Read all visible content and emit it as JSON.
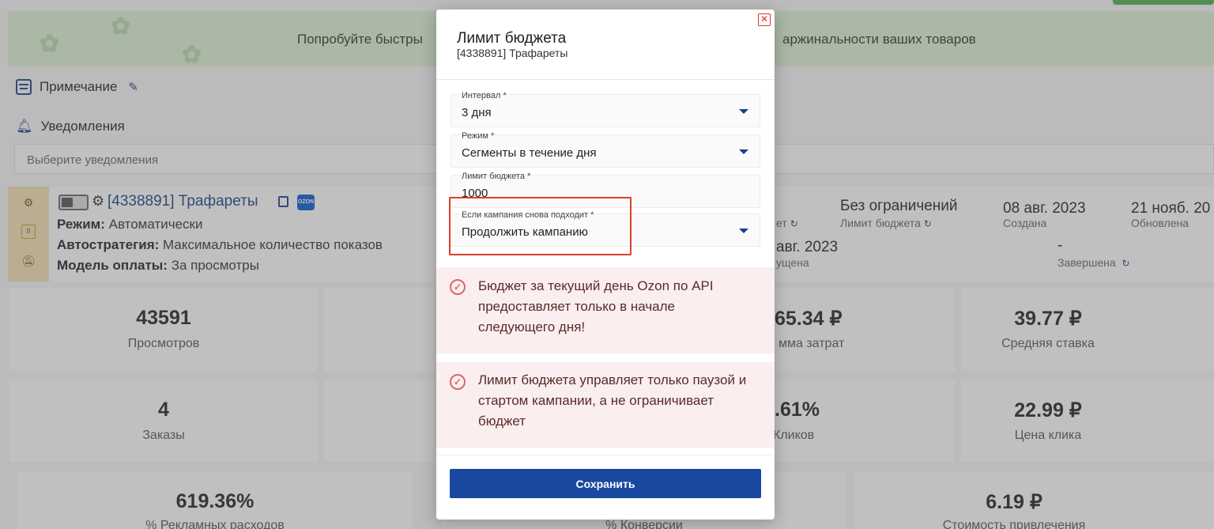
{
  "background": {
    "promo_text_left": "Попробуйте быстры",
    "promo_text_right": "аржинальности ваших товаров",
    "note_label": "Примечание",
    "notifications_label": "Уведомления",
    "notifications_placeholder": "Выберите уведомления",
    "campaign": {
      "title": "[4338891] Трафареты",
      "badge": "OZON",
      "mode_label": "Режим:",
      "mode_value": "Автоматически",
      "strategy_label": "Автостратегия:",
      "strategy_value": "Максимальное количество показов",
      "payment_label": "Модель оплаты:",
      "payment_value": "За просмотры"
    },
    "meta": {
      "limit_value": "Без ограничений",
      "limit_label": "Лимит бюджета",
      "created_value": "08 авг. 2023",
      "created_label": "Создана",
      "updated_value": "21 нояб. 20",
      "updated_label": "Обновлена",
      "launched_value": "авг. 2023",
      "launched_label": "ущена",
      "et_label": "ет",
      "finished_value": "-",
      "finished_label": "Завершена"
    },
    "cards": [
      {
        "value": "43591",
        "label": "Просмотров"
      },
      {
        "value": "65.34 ₽",
        "label": "мма затрат"
      },
      {
        "value": "39.77 ₽",
        "label": "Средняя ставка"
      },
      {
        "value": "4",
        "label": "Заказы"
      },
      {
        "value": ".61%",
        "label": "Кликов"
      },
      {
        "value": "22.99 ₽",
        "label": "Цена клика"
      },
      {
        "value": "619.36%",
        "label": "% Рекламных расходов"
      },
      {
        "value": "",
        "label": "% Конверсии"
      },
      {
        "value": "6.19 ₽",
        "label": "Стоимость привлечения"
      }
    ]
  },
  "modal": {
    "title": "Лимит бюджета",
    "subtitle": "[4338891] Трафареты",
    "fields": {
      "interval": {
        "label": "Интервал *",
        "value": "3 дня"
      },
      "mode": {
        "label": "Режим *",
        "value": "Сегменты в течение дня"
      },
      "budget": {
        "label": "Лимит бюджета *",
        "value": "1000"
      },
      "again": {
        "label": "Если кампания снова подходит *",
        "value": "Продолжить кампанию"
      }
    },
    "alerts": [
      "Бюджет за текущий день Ozon по API предоставляет только в начале следующего дня!",
      "Лимит бюджета управляет только паузой и стартом кампании, а не ограничивает бюджет"
    ],
    "save_label": "Сохранить",
    "close_glyph": "✕"
  }
}
